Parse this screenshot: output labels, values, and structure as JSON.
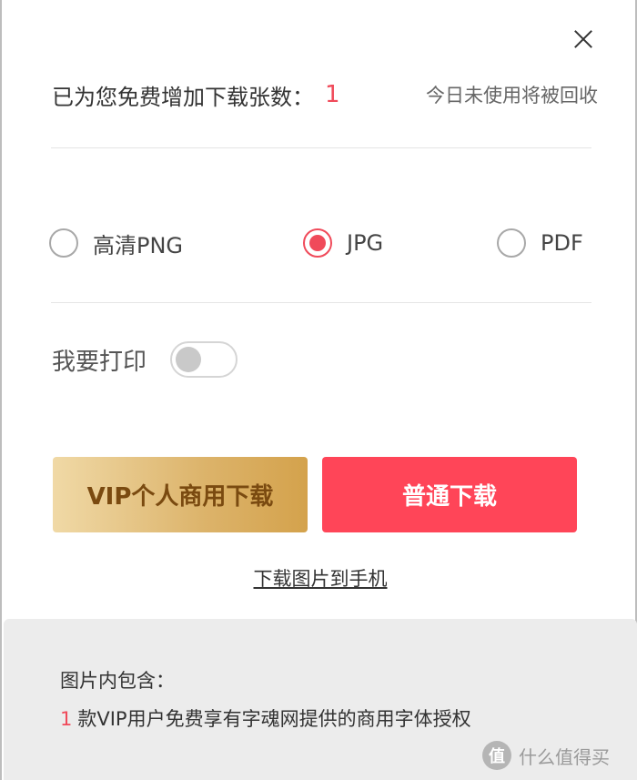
{
  "dialog": {
    "info": {
      "label": "已为您免费增加下载张数：",
      "count": "1",
      "note": "今日未使用将被回收"
    },
    "formats": [
      {
        "label": "高清PNG",
        "checked": false
      },
      {
        "label": "JPG",
        "checked": true
      },
      {
        "label": "PDF",
        "checked": false
      }
    ],
    "print": {
      "label": "我要打印",
      "enabled": false
    },
    "buttons": {
      "vip_label": "VIP个人商用下载",
      "normal_label": "普通下载"
    },
    "mobile_link": "下载图片到手机",
    "footer": {
      "title": "图片内包含：",
      "count": "1",
      "line": "款VIP用户免费享有字魂网提供的商用字体授权"
    }
  },
  "watermark": {
    "icon_glyph": "值",
    "text": "什么值得买"
  },
  "colors": {
    "accent": "#f04a5a",
    "normal_button": "#ff4558",
    "vip_gold": "#d4a24c"
  }
}
